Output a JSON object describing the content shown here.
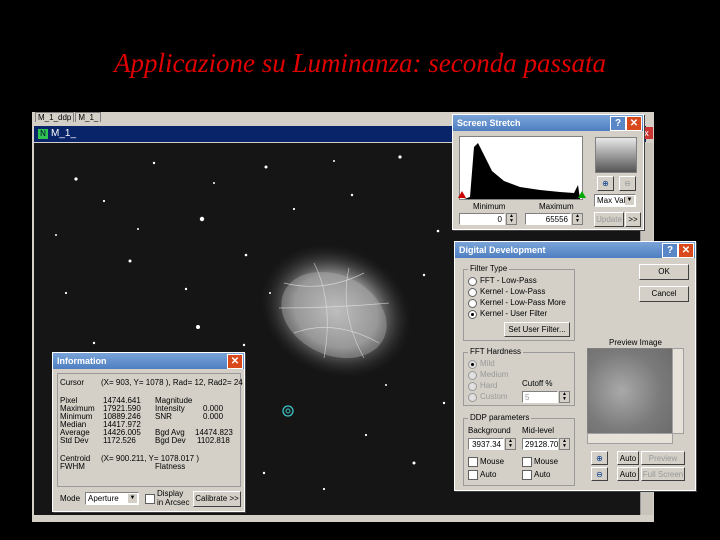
{
  "slide_title": "Applicazione  su Luminanza: seconda passata",
  "tabs": [
    "M_1_ddp",
    "M_1_"
  ],
  "image_window_title": "M_1_",
  "screen_stretch": {
    "title": "Screen Stretch",
    "minimum_label": "Minimum",
    "maximum_label": "Maximum",
    "minimum_value": "0",
    "maximum_value": "65556",
    "mode_value": "Max Val",
    "update_label": "Update",
    "more_label": ">>"
  },
  "digital_development": {
    "title": "Digital Development",
    "ok_label": "OK",
    "cancel_label": "Cancel",
    "filter_type": {
      "label": "Filter Type",
      "options": [
        "FFT - Low-Pass",
        "Kernel - Low-Pass",
        "Kernel - Low-Pass More",
        "Kernel - User Filter"
      ],
      "selected_index": 3,
      "set_user_filter_label": "Set User Filter..."
    },
    "fft_hardness": {
      "label": "FFT Hardness",
      "options": [
        "Mild",
        "Medium",
        "Hard",
        "Custom"
      ],
      "cutoff_label": "Cutoff %",
      "cutoff_value": "5"
    },
    "ddp_parameters": {
      "label": "DDP parameters",
      "background_label": "Background",
      "midlevel_label": "Mid-level",
      "background_value": "3937.34",
      "midlevel_value": "29128.70",
      "mouse_label": "Mouse",
      "auto_label": "Auto"
    },
    "preview_label": "Preview Image",
    "auto_label": "Auto",
    "preview_button": "Preview",
    "full_screen_button": "Full Screen"
  },
  "information": {
    "title": "Information",
    "cursor_label": "Cursor",
    "cursor_value": "(X=  903, Y= 1078 ), Rad= 12, Rad2= 24",
    "left_labels": [
      "Pixel",
      "Maximum",
      "Minimum",
      "Median",
      "Average",
      "Std Dev"
    ],
    "left_values": [
      "14744.641",
      "17921.590",
      "10889.246",
      "14417.972",
      "14426.005",
      "1172.526"
    ],
    "right_labels": [
      "Magnitude",
      "Intensity",
      "SNR",
      "",
      "Bgd Avg",
      "Bgd Dev"
    ],
    "right_values": [
      "",
      "0.000",
      "0.000",
      "",
      "14474.823",
      "1102.818"
    ],
    "centroid_label": "Centroid",
    "centroid_value": "(X=  900.211, Y= 1078.017 )",
    "fwhm_label": "FWHM",
    "flatness_label": "Flatness",
    "mode_label": "Mode",
    "mode_value": "Aperture",
    "display_arcsec_label": "Display in Arcsec",
    "calibrate_label": "Calibrate >>"
  },
  "icons": [
    "zoom-in-icon",
    "zoom-out-icon",
    "close-icon",
    "help-icon",
    "aperture-cursor-icon"
  ]
}
